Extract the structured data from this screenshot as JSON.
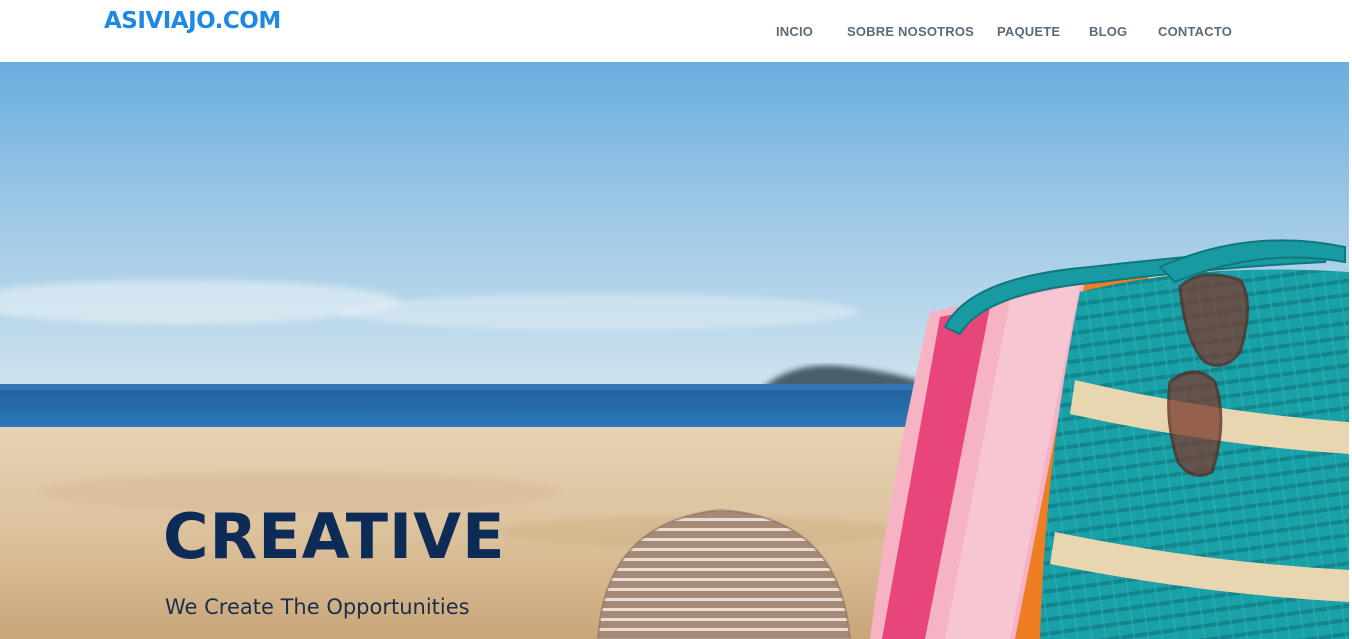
{
  "header": {
    "brand": "ASIVIAJO.COM",
    "nav": [
      {
        "label": "INCIO"
      },
      {
        "label": "SOBRE NOSOTROS"
      },
      {
        "label": "PAQUETE"
      },
      {
        "label": "BLOG"
      },
      {
        "label": "CONTACTO"
      }
    ]
  },
  "hero": {
    "title": "CREATIVE",
    "subtitle": "We Create The Opportunities",
    "image_subject": "beach-bag-towel-hat-photo"
  },
  "colors": {
    "brand": "#1e88e5",
    "nav_text": "#5a6b7c",
    "hero_title": "#0d2b57",
    "hero_subtitle": "#1b2f4a"
  }
}
